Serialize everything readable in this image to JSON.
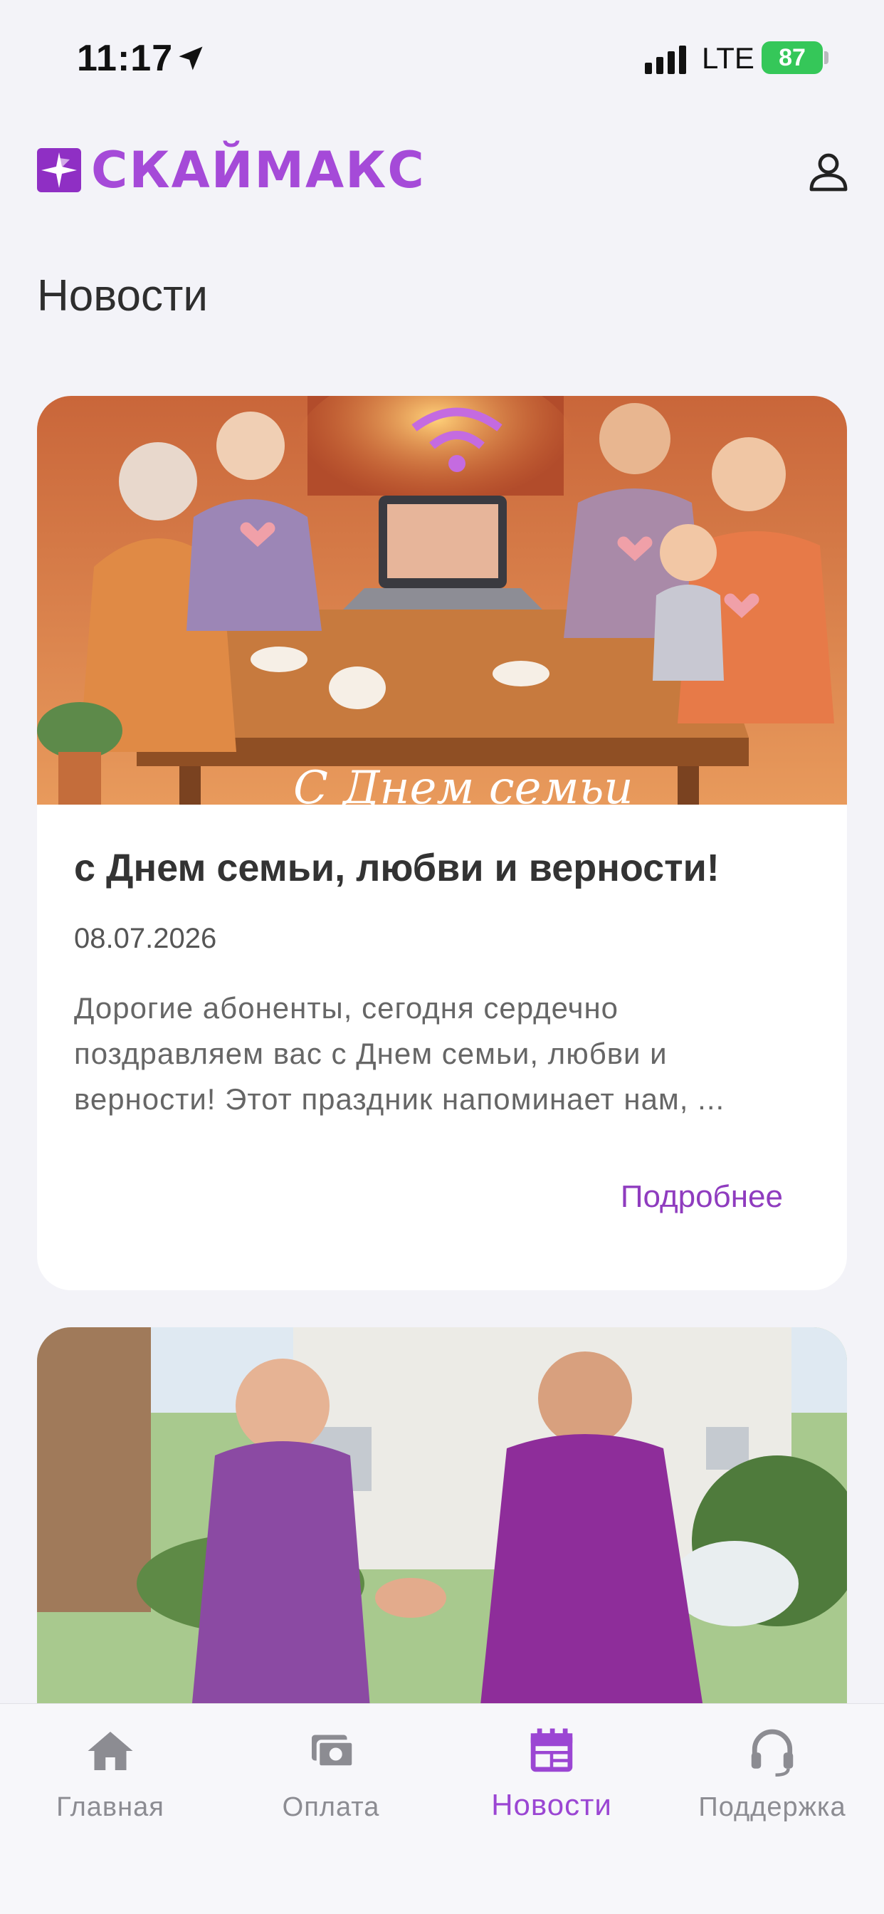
{
  "status": {
    "time": "11:17",
    "network": "LTE",
    "battery": "87"
  },
  "header": {
    "logo_text": "СКАЙМАКС"
  },
  "page": {
    "title": "Новости"
  },
  "news": [
    {
      "title": "с Днем семьи, любви и верности!",
      "date": "08.07.2026",
      "excerpt": "Дорогие абоненты, сегодня сердечно поздравляем вас с Днем семьи, любви и верности! Этот праздник напоминает нам, ...",
      "more_label": "Подробнее",
      "image_caption": "С Днем семьи"
    }
  ],
  "tabs": [
    {
      "label": "Главная",
      "icon": "home-icon",
      "active": false
    },
    {
      "label": "Оплата",
      "icon": "payment-icon",
      "active": false
    },
    {
      "label": "Новости",
      "icon": "news-icon",
      "active": true
    },
    {
      "label": "Поддержка",
      "icon": "headset-icon",
      "active": false
    }
  ],
  "colors": {
    "brand": "#a54ad8",
    "brand_dark": "#8f2fc4",
    "accent_link": "#8f3cbf",
    "battery": "#35c759",
    "background": "#f3f3f8"
  }
}
